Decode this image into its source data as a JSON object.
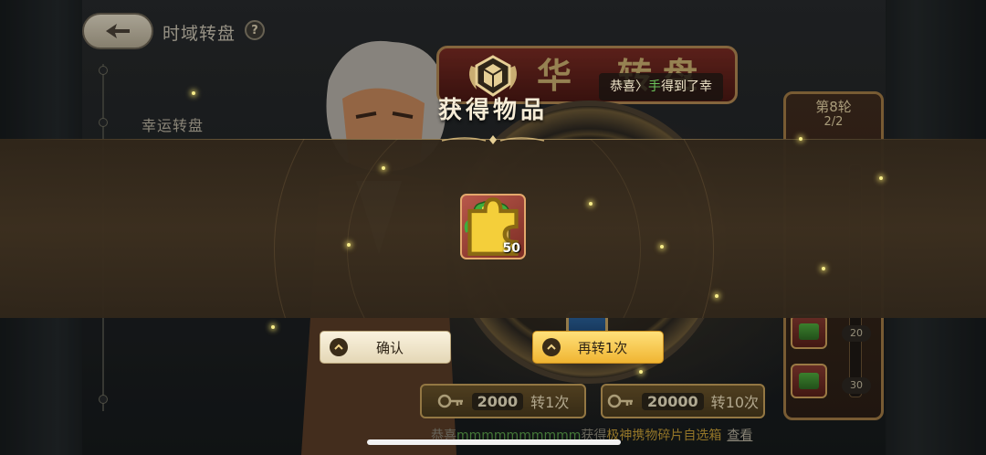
{
  "header": {
    "title": "时域转盘",
    "help_icon": "question-mark-icon"
  },
  "side_nav": {
    "lucky_wheel_label": "幸运转盘"
  },
  "banner": {
    "chars": [
      "华",
      "转",
      "盘"
    ]
  },
  "round_panel": {
    "title": "第8轮",
    "count": "2/2",
    "progress_marks": [
      "20",
      "30"
    ]
  },
  "spin_buttons": {
    "once": {
      "cost": "2000",
      "label": "转1次",
      "icon": "key-icon"
    },
    "ten": {
      "cost": "20000",
      "label": "转10次",
      "icon": "key-icon"
    }
  },
  "ticker": {
    "prefix": "恭喜",
    "player": "mmmmmmmmmm",
    "verb": "获得",
    "item": "极神携物碎片自选箱",
    "view_label": "查看"
  },
  "toast": {
    "prefix": "恭喜〉",
    "player": "手",
    "suffix": "得到了幸"
  },
  "modal": {
    "title": "获得物品",
    "reward": {
      "icon": "dragon-treasure-chest-icon",
      "quantity": "50"
    },
    "confirm_label": "确认",
    "again_label": "再转1次"
  },
  "colors": {
    "accent_gold": "#f0b532",
    "band_brown": "#3c2f1f",
    "confirm_cream": "#f5ecd6"
  }
}
